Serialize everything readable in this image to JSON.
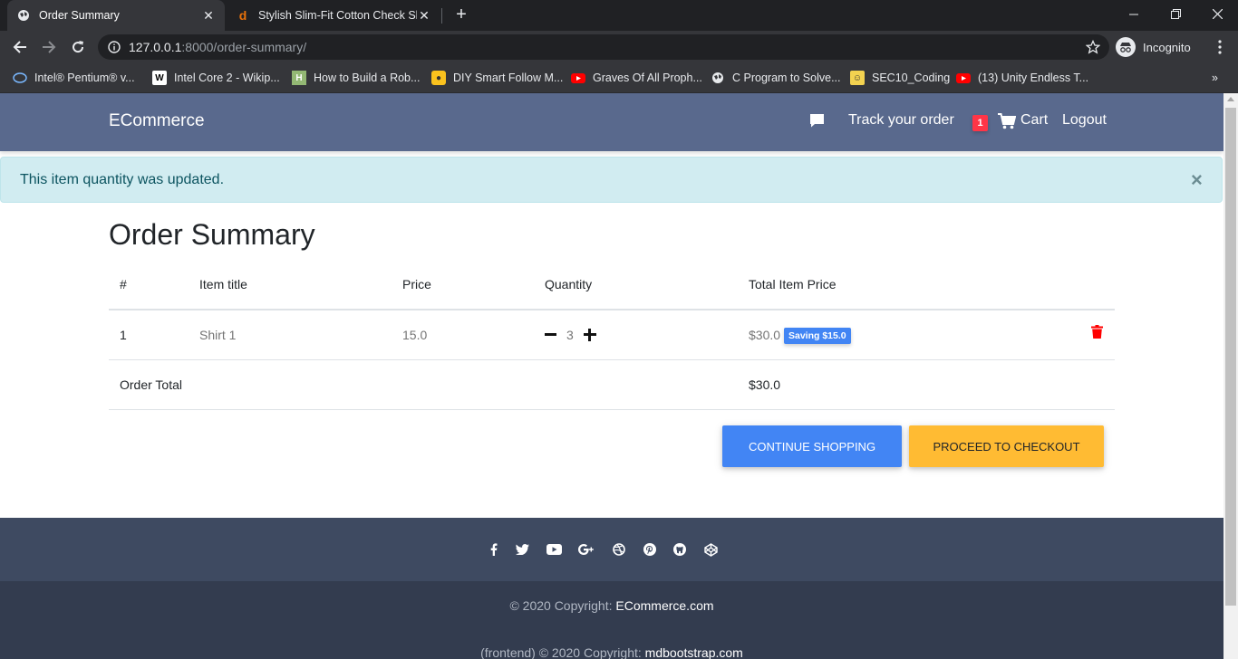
{
  "browser": {
    "tabs": [
      {
        "title": "Order Summary",
        "active": true
      },
      {
        "title": "Stylish Slim-Fit Cotton Check Shirt",
        "active": false
      }
    ],
    "url_host": "127.0.0.1",
    "url_path": ":8000/order-summary/",
    "profile_label": "Incognito",
    "bookmarks": [
      "Intel® Pentium® v...",
      "Intel Core 2 - Wikip...",
      "How to Build a Rob...",
      "DIY Smart Follow M...",
      "Graves Of All Proph...",
      "C Program to Solve...",
      "SEC10_Coding",
      "(13) Unity Endless T..."
    ]
  },
  "navbar": {
    "brand": "ECommerce",
    "track_label": "Track your order",
    "cart_count": "1",
    "cart_label": "Cart",
    "logout_label": "Logout"
  },
  "alert": {
    "message": "This item quantity was updated.",
    "close": "×"
  },
  "order": {
    "title": "Order Summary",
    "headers": [
      "#",
      "Item title",
      "Price",
      "Quantity",
      "Total Item Price"
    ],
    "rows": [
      {
        "index": "1",
        "title": "Shirt 1",
        "price": "15.0",
        "quantity": "3",
        "total": "$30.0",
        "saving": "Saving $15.0"
      }
    ],
    "total_label": "Order Total",
    "total_value": "$30.0",
    "continue_label": "Continue shopping",
    "checkout_label": "Proceed to checkout"
  },
  "footer": {
    "social_icons": [
      "facebook-icon",
      "twitter-icon",
      "youtube-icon",
      "google-plus-icon",
      "dribbble-icon",
      "pinterest-icon",
      "github-icon",
      "codepen-icon"
    ],
    "copyright_prefix": "© 2020 Copyright: ",
    "copyright_link": "ECommerce.com",
    "frontend_prefix": "(frontend) © 2020 Copyright: ",
    "frontend_link": "mdbootstrap.com"
  },
  "colors": {
    "navbar": "#59698d",
    "alert_bg": "#d1ecf1",
    "primary": "#4285f4",
    "warning": "#ffbb33",
    "danger": "#ff3547",
    "footer_top": "#3e4a61",
    "footer_bottom": "#333c4f"
  }
}
